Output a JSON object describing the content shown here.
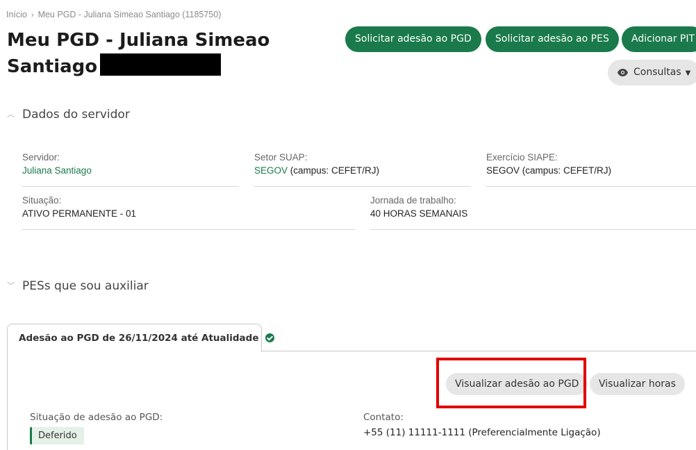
{
  "breadcrumb": {
    "items": [
      "Início",
      "Meu PGD - Juliana Simeao Santiago (1185750)"
    ],
    "separator": "›"
  },
  "header": {
    "title": "Meu PGD - Juliana Simeao Santiago"
  },
  "actions": {
    "solicitar_pgd": "Solicitar adesão ao PGD",
    "solicitar_pes": "Solicitar adesão ao PES",
    "adicionar_pit": "Adicionar PIT",
    "consultas": "Consultas"
  },
  "dados_servidor": {
    "section_title": "Dados do servidor",
    "servidor": {
      "label": "Servidor:",
      "value": "Juliana Santiago"
    },
    "setor_suap": {
      "label": "Setor SUAP:",
      "value_link": "SEGOV",
      "value_rest": " (campus: CEFET/RJ)"
    },
    "exercicio_siape": {
      "label": "Exercício SIAPE:",
      "value": "SEGOV (campus: CEFET/RJ)"
    },
    "situacao": {
      "label": "Situação:",
      "value": "ATIVO PERMANENTE - 01"
    },
    "jornada": {
      "label": "Jornada de trabalho:",
      "value": "40 HORAS SEMANAIS"
    }
  },
  "pes_section": {
    "title": "PESs que sou auxiliar"
  },
  "adesao_tab": {
    "label": "Adesão ao PGD de 26/11/2024 até Atualidade",
    "visualizar_adesao": "Visualizar adesão ao PGD",
    "visualizar_horas": "Visualizar horas",
    "situacao": {
      "label": "Situação de adesão ao PGD:",
      "value": "Deferido"
    },
    "contato": {
      "label": "Contato:",
      "value": "+55 (11) 11111-1111 (Preferencialmente Ligação)"
    }
  },
  "colors": {
    "primary_green": "#1a7a4b",
    "highlight_red": "#e00000"
  }
}
